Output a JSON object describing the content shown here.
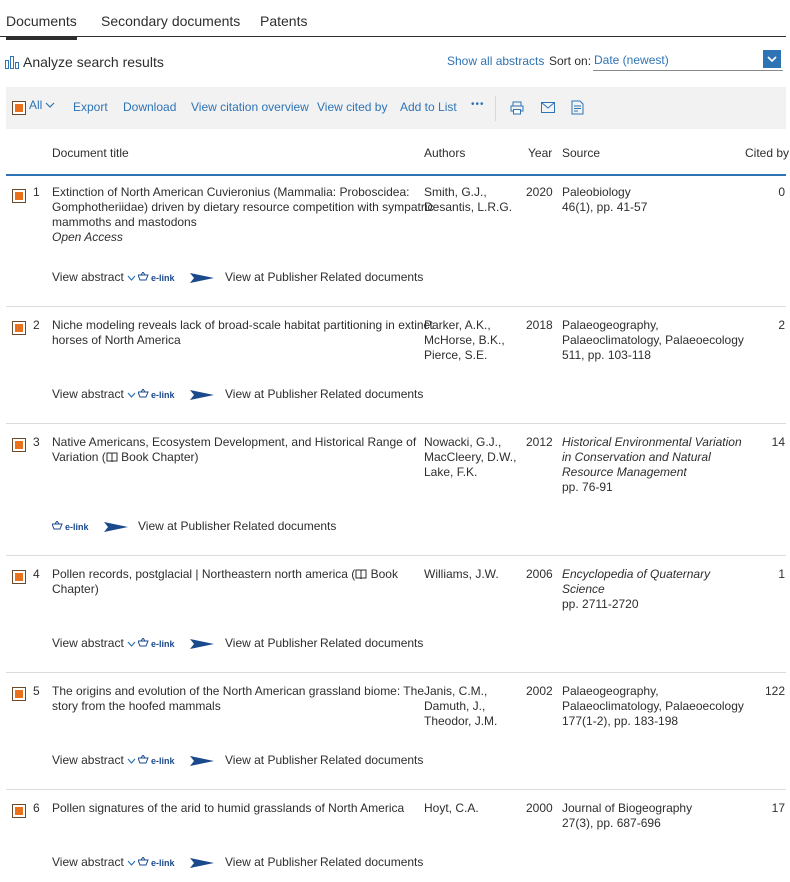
{
  "tabs": [
    "Documents",
    "Secondary documents",
    "Patents"
  ],
  "analyze_label": "Analyze search results",
  "show_all_abstracts": "Show all abstracts",
  "sort_label": "Sort on:",
  "sort_value": "Date (newest)",
  "toolbar": {
    "all_label": "All",
    "actions": [
      "Export",
      "Download",
      "View citation overview",
      "View cited by",
      "Add to List"
    ],
    "more": "•••"
  },
  "columns": {
    "title": "Document title",
    "authors": "Authors",
    "year": "Year",
    "source": "Source",
    "cited_by": "Cited by"
  },
  "row_actions": {
    "view_abstract": "View abstract",
    "elink": "e-link",
    "view_publisher": "View at Publisher",
    "related": "Related documents"
  },
  "rows": [
    {
      "num": "1",
      "title": [
        "Extinction of North American Cuvieronius (Mammalia: Proboscidea:",
        "Gomphotheriidae) driven by dietary resource competition with sympatric",
        "mammoths and mastodons"
      ],
      "access": "Open Access",
      "authors": [
        "Smith, G.J.,",
        "Desantis, L.R.G."
      ],
      "year": "2020",
      "source": [
        "Paleobiology",
        "46(1), pp. 41-57"
      ],
      "source_italic": false,
      "cited": "0"
    },
    {
      "num": "2",
      "title": [
        "Niche modeling reveals lack of broad-scale habitat partitioning in extinct",
        "horses of North America"
      ],
      "authors": [
        "Parker, A.K.,",
        "McHorse, B.K.,",
        "Pierce, S.E."
      ],
      "year": "2018",
      "source": [
        "Palaeogeography,",
        "Palaeoclimatology, Palaeoecology",
        "511, pp. 103-118"
      ],
      "source_italic": false,
      "cited": "2"
    },
    {
      "num": "3",
      "title": [
        "Native Americans, Ecosystem Development, and Historical Range of",
        "Variation ("
      ],
      "title_suffix": " Book Chapter)",
      "authors": [
        "Nowacki, G.J.,",
        "MacCleery, D.W.,",
        "Lake, F.K."
      ],
      "year": "2012",
      "source": [
        "Historical Environmental Variation",
        "in Conservation and Natural",
        "Resource Management"
      ],
      "source_pages": "pp. 76-91",
      "source_italic": true,
      "cited": "14"
    },
    {
      "num": "4",
      "title": [
        "Pollen records, postglacial | Northeastern north america ("
      ],
      "title_suffix": " Book",
      "title_line2": "Chapter)",
      "authors": [
        "Williams, J.W."
      ],
      "year": "2006",
      "source": [
        "Encyclopedia of Quaternary",
        "Science"
      ],
      "source_pages": "pp. 2711-2720",
      "source_italic": true,
      "cited": "1"
    },
    {
      "num": "5",
      "title": [
        "The origins and evolution of the North American grassland biome: The",
        "story from the hoofed mammals"
      ],
      "authors": [
        "Janis, C.M.,",
        "Damuth, J.,",
        "Theodor, J.M."
      ],
      "year": "2002",
      "source": [
        "Palaeogeography,",
        "Palaeoclimatology, Palaeoecology",
        "177(1-2), pp. 183-198"
      ],
      "source_italic": false,
      "cited": "122"
    },
    {
      "num": "6",
      "title": [
        "Pollen signatures of the arid to humid grasslands of North America"
      ],
      "authors": [
        "Hoyt, C.A."
      ],
      "year": "2000",
      "source": [
        "Journal of Biogeography",
        "27(3), pp. 687-696"
      ],
      "source_italic": false,
      "cited": "17"
    }
  ]
}
